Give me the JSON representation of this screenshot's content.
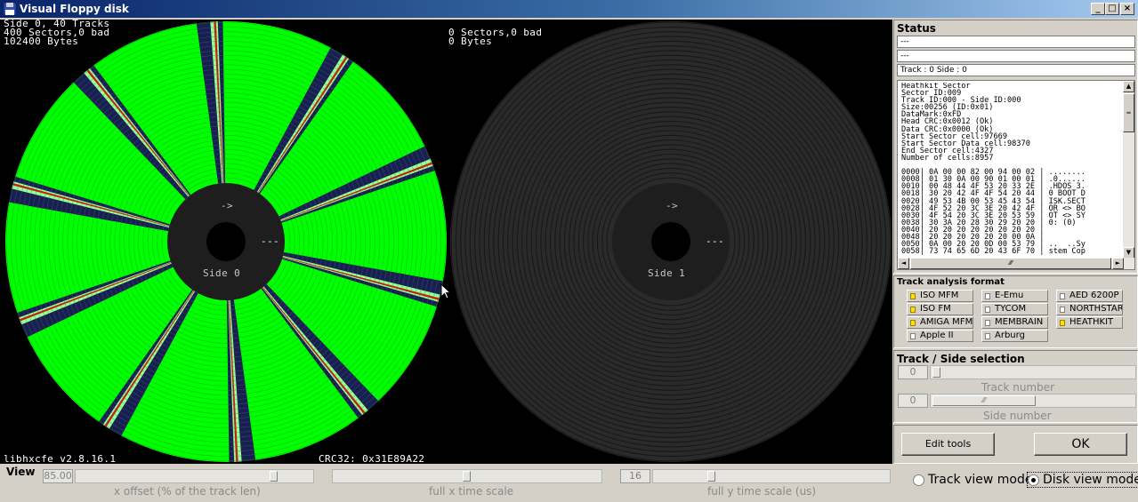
{
  "window": {
    "title": "Visual Floppy disk",
    "btn_min": "_",
    "btn_max": "□",
    "btn_close": "×"
  },
  "disk_view": {
    "side0": {
      "line1": "Side 0, 40 Tracks",
      "line2": "400 Sectors,0 bad",
      "line3": "102400 Bytes",
      "label": "Side 0",
      "arrow": "->",
      "index_mark": "---"
    },
    "side1": {
      "line1": "0 Sectors,0 bad",
      "line2": "0 Bytes",
      "label": "Side 1",
      "arrow": "->",
      "index_mark": "---"
    },
    "library_version": "libhxcfe v2.8.16.1",
    "crc": "CRC32: 0x31E89A22",
    "colors": {
      "ok_sector": "#00ff00",
      "sector_gap": "#1c1c58",
      "sector_header": "#99ff99",
      "track_line": "#0a9a0a",
      "empty_track": "#2a2a2a",
      "hub": "#1e1e1e"
    }
  },
  "status": {
    "title": "Status",
    "field1": "---",
    "field2": "---",
    "field3": "Track : 0 Side : 0",
    "info_lines": [
      "Heathkit Sector",
      "Sector ID:009",
      "Track ID:000 - Side ID:000",
      "Size:00256 (ID:0x01)",
      "DataMark:0xFD",
      "Head CRC:0x0012 (Ok)",
      "Data CRC:0x0000 (Ok)",
      "Start Sector cell:97669",
      "Start Sector Data cell:98370",
      "End Sector cell:4327",
      "Number of cells:8957",
      "",
      "0000| 0A 00 00 82 00 94 00 02 | ........",
      "0008| 01 30 0A 00 90 01 00 01 | .0......",
      "0010| 00 48 44 4F 53 20 33 2E | .HDOS 3.",
      "0018| 30 20 42 4F 4F 54 20 44 | 0 BOOT D",
      "0020| 49 53 4B 00 53 45 43 54 | ISK.SECT",
      "0028| 4F 52 20 3C 3E 20 42 4F | OR <> BO",
      "0030| 4F 54 20 3C 3E 20 53 59 | OT <> SY",
      "0038| 30 3A 20 28 30 29 20 20 | 0: (0)",
      "0040| 20 20 20 20 20 20 20 20 |",
      "0048| 20 20 20 20 20 20 00 0A |",
      "0050| 0A 00 20 20 0D 00 53 79 | ..  ..Sy",
      "0058| 73 74 65 6D 20 43 6F 70 | stem Cop"
    ]
  },
  "track_analysis": {
    "title": "Track analysis format",
    "formats": [
      {
        "label": "ISO MFM",
        "checked": true
      },
      {
        "label": "E-Emu",
        "checked": false
      },
      {
        "label": "AED 6200P",
        "checked": false
      },
      {
        "label": "ISO FM",
        "checked": true
      },
      {
        "label": "TYCOM",
        "checked": false
      },
      {
        "label": "NORTHSTAR",
        "checked": false
      },
      {
        "label": "AMIGA MFM",
        "checked": true
      },
      {
        "label": "MEMBRAIN",
        "checked": false
      },
      {
        "label": "HEATHKIT",
        "checked": true
      },
      {
        "label": "Apple II",
        "checked": false
      },
      {
        "label": "Arburg",
        "checked": false
      }
    ]
  },
  "track_side": {
    "title": "Track / Side selection",
    "track_value": "0",
    "track_label": "Track number",
    "side_value": "0",
    "side_label": "Side number"
  },
  "buttons": {
    "edit_tools": "Edit tools",
    "ok": "OK"
  },
  "view": {
    "title": "View",
    "x_offset_value": "85.00",
    "x_offset_position": 0.85,
    "x_offset_label": "x offset (% of the track len)",
    "x_time_position": 0.5,
    "x_time_label": "full x time scale",
    "y_time_value": "16",
    "y_time_position": 0.24,
    "y_time_label": "full y time scale (us)",
    "mode_track": "Track view mode",
    "mode_disk": "Disk view mode",
    "selected_mode": "disk"
  }
}
